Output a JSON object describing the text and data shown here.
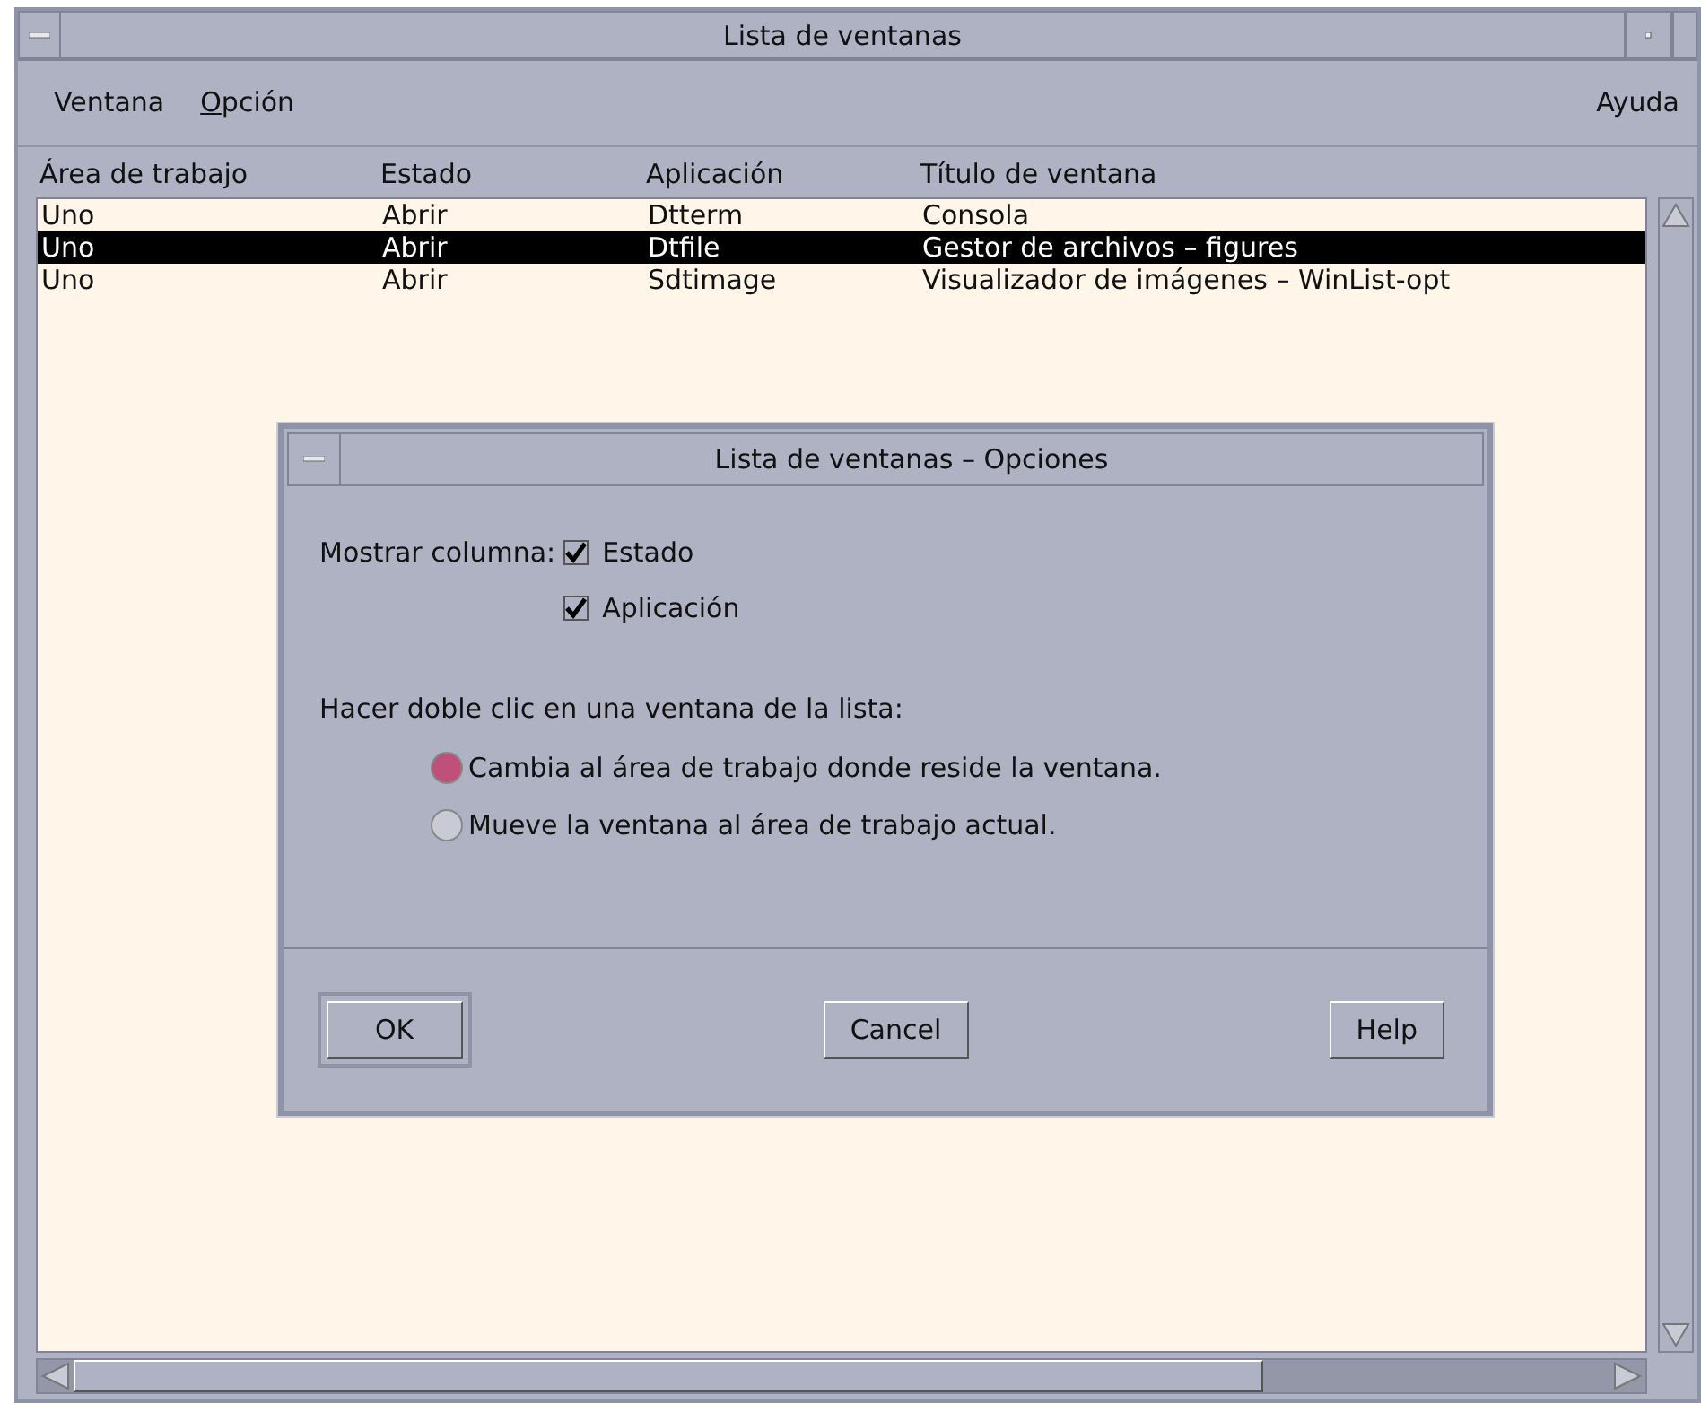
{
  "window": {
    "title": "Lista de ventanas"
  },
  "menus": [
    {
      "label": "Ventana",
      "mnemonic": false
    },
    {
      "label": "Opción",
      "mnemonic": true
    },
    {
      "label": "Ayuda",
      "mnemonic": false
    }
  ],
  "table": {
    "columns": [
      "Área de trabajo",
      "Estado",
      "Aplicación",
      "Título de ventana"
    ],
    "rows": [
      {
        "cells": [
          "Uno",
          "Abrir",
          "Dtterm",
          "Consola"
        ],
        "selected": false
      },
      {
        "cells": [
          "Uno",
          "Abrir",
          "Dtfile",
          "Gestor de archivos – figures"
        ],
        "selected": true
      },
      {
        "cells": [
          "Uno",
          "Abrir",
          "Sdtimage",
          "Visualizador de imágenes – WinList-opt"
        ],
        "selected": false
      }
    ]
  },
  "dialog": {
    "title": "Lista de ventanas – Opciones",
    "show_label": "Mostrar columna:",
    "checkboxes": [
      {
        "label": "Estado",
        "checked": true
      },
      {
        "label": "Aplicación",
        "checked": true
      }
    ],
    "double_click_label": "Hacer doble clic en una ventana de la lista:",
    "radios": [
      {
        "label": "Cambia al área de trabajo donde reside la ventana.",
        "selected": true
      },
      {
        "label": "Mueve la ventana al área de trabajo actual.",
        "selected": false
      }
    ],
    "buttons": [
      {
        "label": "OK",
        "default": true
      },
      {
        "label": "Cancel",
        "default": false
      },
      {
        "label": "Help",
        "default": false
      }
    ]
  }
}
